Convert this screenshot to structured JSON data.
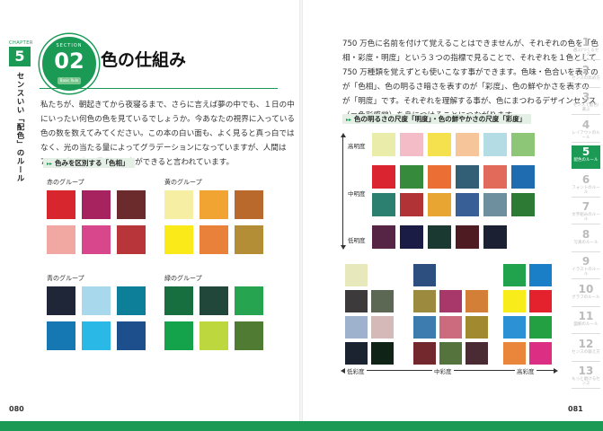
{
  "left_page": {
    "chapter_label": "CHAPTER",
    "chapter_number": "5",
    "chapter_title": "センスいい「配色」のルール",
    "section_label": "SECTION",
    "section_number": "02",
    "section_sub": "Basic Rule",
    "title": "色の仕組み",
    "paragraph_lines": [
      "私たちが、朝起きてから夜寝るまで、さらに言えば夢の中でも、１日の中",
      "にいったい何色の色を見ているでしょうか。今あなたの視界に入っている",
      "色の数を数えてみてください。この本の白い面も、よく見ると真っ白では",
      "なく、光の当たる量によってグラデーションになっていますが、人間は",
      "750 万色の色を見分ける事ができると言われています。"
    ],
    "subhead": "色みを区別する「色相」",
    "groups": [
      {
        "label": "赤のグループ",
        "colors": [
          "#d8262e",
          "#a62360",
          "#6b2a2c",
          "#f1a8a2",
          "#d8468b",
          "#b8353a"
        ]
      },
      {
        "label": "黄のグループ",
        "colors": [
          "#f6eea2",
          "#f2a433",
          "#b9692c",
          "#faea1a",
          "#ea813b",
          "#b48e36"
        ]
      },
      {
        "label": "青のグループ",
        "colors": [
          "#1f2637",
          "#a8d8ec",
          "#0e7f99",
          "#1678b3",
          "#2ab8e6",
          "#1d4f8c"
        ]
      },
      {
        "label": "緑のグループ",
        "colors": [
          "#176e3e",
          "#21473a",
          "#27a450",
          "#14a34b",
          "#bdd73f",
          "#4f7b33"
        ]
      }
    ],
    "page_number": "080"
  },
  "right_page": {
    "paragraph_lines": [
      "750 万色に名前を付けて覚えることはできませんが、それぞれの色を「色",
      "相・彩度・明度」という３つの指標で見ることで、それぞれを１色として",
      "750 万種類を覚えずとも使いこなす事ができます。色味・色合いを表すの",
      "が「色相」、色の明るさ暗さを表すのが「彩度」、色の鮮やかさを表すの",
      "が「明度」です。それぞれを理解する事が、色にまつわるデザインセンス",
      "（＝色彩感覚）を身につけることにつながります。"
    ],
    "subhead": "色の明るさの尺度「明度」・色の鮮やかさの尺度「彩度」",
    "brightness_labels": {
      "high": "高明度",
      "mid": "中明度",
      "low": "低明度"
    },
    "brightness_rows": [
      [
        "#eaedaa",
        "#f4bcc6",
        "#f5e04e",
        "#f6c59a",
        "#b3dce5",
        "#8cc676"
      ],
      [
        "#da2530",
        "#358a3b",
        "#eb6e34",
        "#325e76",
        "#e26a5a",
        "#1f6cb0"
      ],
      [
        "#2c806f",
        "#b13336",
        "#e9a531",
        "#385f96",
        "#6e8f9d",
        "#2c7a33"
      ],
      [
        "#562444",
        "#1b1c46",
        "#1a3a31",
        "#4f1b22",
        "#1b2132"
      ]
    ],
    "chroma_labels": {
      "low": "低彩度",
      "mid": "中彩度",
      "high": "高彩度"
    },
    "chroma_low": [
      "#e7e9bd",
      "#3c3a3a",
      "#5c6754",
      "#9eb2cd",
      "#d4b9b8",
      "#5f6d84",
      "#465445",
      "#1b2230",
      "#0f2316"
    ],
    "chroma_mid": [
      "#2d4f7f",
      "#9c8a3f",
      "#a8386a",
      "#d37f37",
      "#3d7cae",
      "#cc6b7d",
      "#a0892f",
      "#73282d",
      "#8f2f42",
      "#487240",
      "#55743d",
      "#4b2b33"
    ],
    "chroma_high": [
      "#21a24c",
      "#f8ec1a",
      "#e4222e",
      "#2c91d5",
      "#23a041",
      "#e9863b",
      "#dc2f84",
      "#1a7fc6"
    ],
    "page_number": "081",
    "side_tabs": [
      {
        "n": "1",
        "label": "選ぶ/つくるセンス"
      },
      {
        "n": "2",
        "label": "センスの高め方"
      },
      {
        "n": "3",
        "label": "センスで配色/選ぶ"
      },
      {
        "n": "4",
        "label": "レイアウトのルール"
      },
      {
        "n": "5",
        "label": "配色のルール"
      },
      {
        "n": "6",
        "label": "フォントのルール"
      },
      {
        "n": "7",
        "label": "文字組みのルール"
      },
      {
        "n": "8",
        "label": "写真のルール"
      },
      {
        "n": "9",
        "label": "イラストのルール"
      },
      {
        "n": "10",
        "label": "グラフのルール"
      },
      {
        "n": "11",
        "label": "図解のルール"
      },
      {
        "n": "12",
        "label": "センスの鍛え方"
      },
      {
        "n": "13",
        "label": "もっと磨けるセンス"
      }
    ]
  }
}
